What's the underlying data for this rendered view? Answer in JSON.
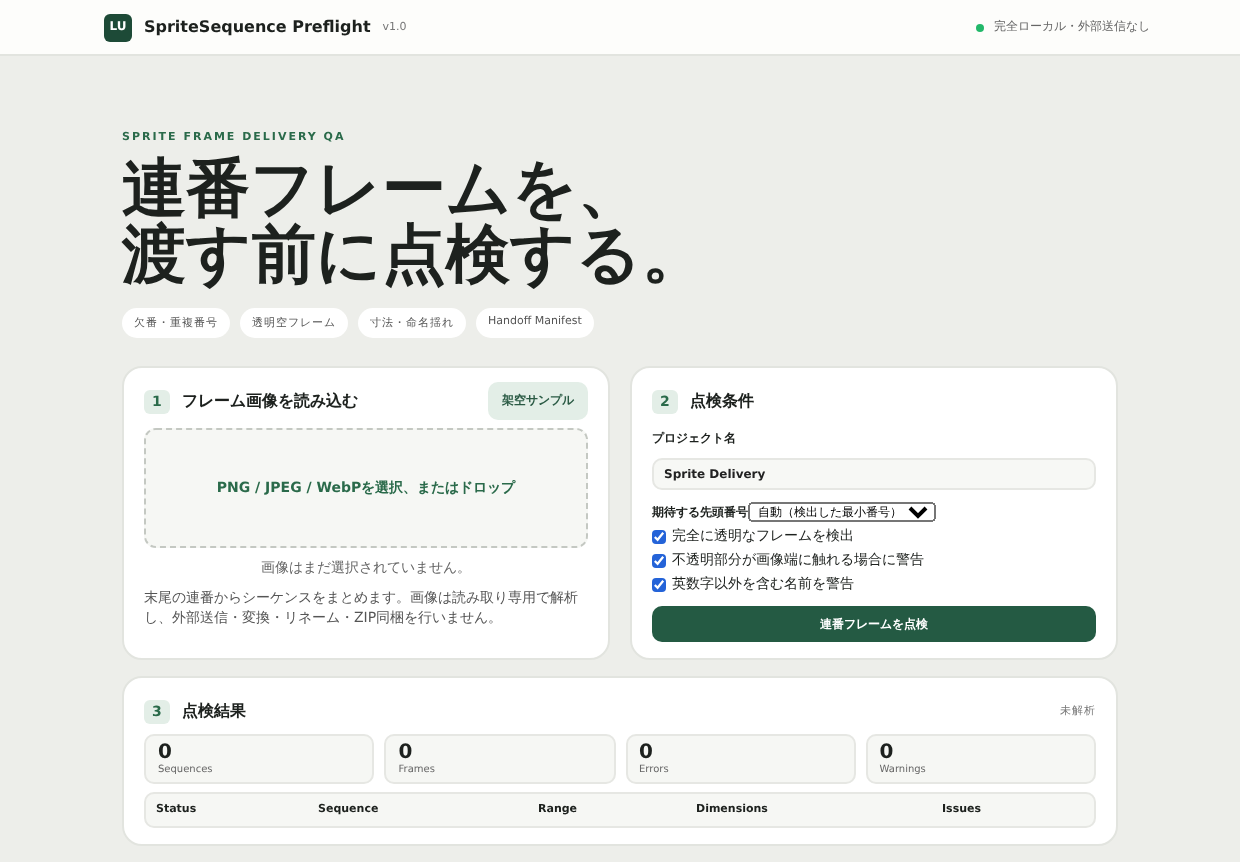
{
  "header": {
    "logo": "LU",
    "app_name": "SpriteSequence Preflight",
    "version": "v1.0",
    "status": "完全ローカル・外部送信なし"
  },
  "hero": {
    "eyebrow": "SPRITE FRAME DELIVERY QA",
    "title_lines": [
      "連番フレームを、",
      "渡す前に点検する。"
    ],
    "chips": [
      "欠番・重複番号",
      "透明空フレーム",
      "寸法・命名揺れ",
      "Handoff Manifest"
    ]
  },
  "load_card": {
    "step": "1",
    "title": "フレーム画像を読み込む",
    "sample_button": "架空サンプル",
    "dropzone": "PNG / JPEG / WebPを選択、またはドロップ",
    "file_status": "画像はまだ選択されていません。",
    "note": "末尾の連番からシーケンスをまとめます。画像は読み取り専用で解析し、外部送信・変換・リネーム・ZIP同梱を行いません。"
  },
  "settings_card": {
    "step": "2",
    "title": "点検条件",
    "project_label": "プロジェクト名",
    "project_value": "Sprite Delivery",
    "start_label": "期待する先頭番号",
    "start_value": "自動（検出した最小番号）",
    "options": [
      {
        "label": "完全に透明なフレームを検出",
        "checked": true
      },
      {
        "label": "不透明部分が画像端に触れる場合に警告",
        "checked": true
      },
      {
        "label": "英数字以外を含む名前を警告",
        "checked": true
      }
    ],
    "run_button": "連番フレームを点検"
  },
  "results_card": {
    "step": "3",
    "title": "点検結果",
    "state": "未解析",
    "stats": [
      {
        "value": "0",
        "label": "Sequences"
      },
      {
        "value": "0",
        "label": "Frames"
      },
      {
        "value": "0",
        "label": "Errors"
      },
      {
        "value": "0",
        "label": "Warnings"
      }
    ],
    "table": {
      "columns": [
        "Status",
        "Sequence",
        "Range",
        "Dimensions",
        "Issues"
      ]
    }
  }
}
